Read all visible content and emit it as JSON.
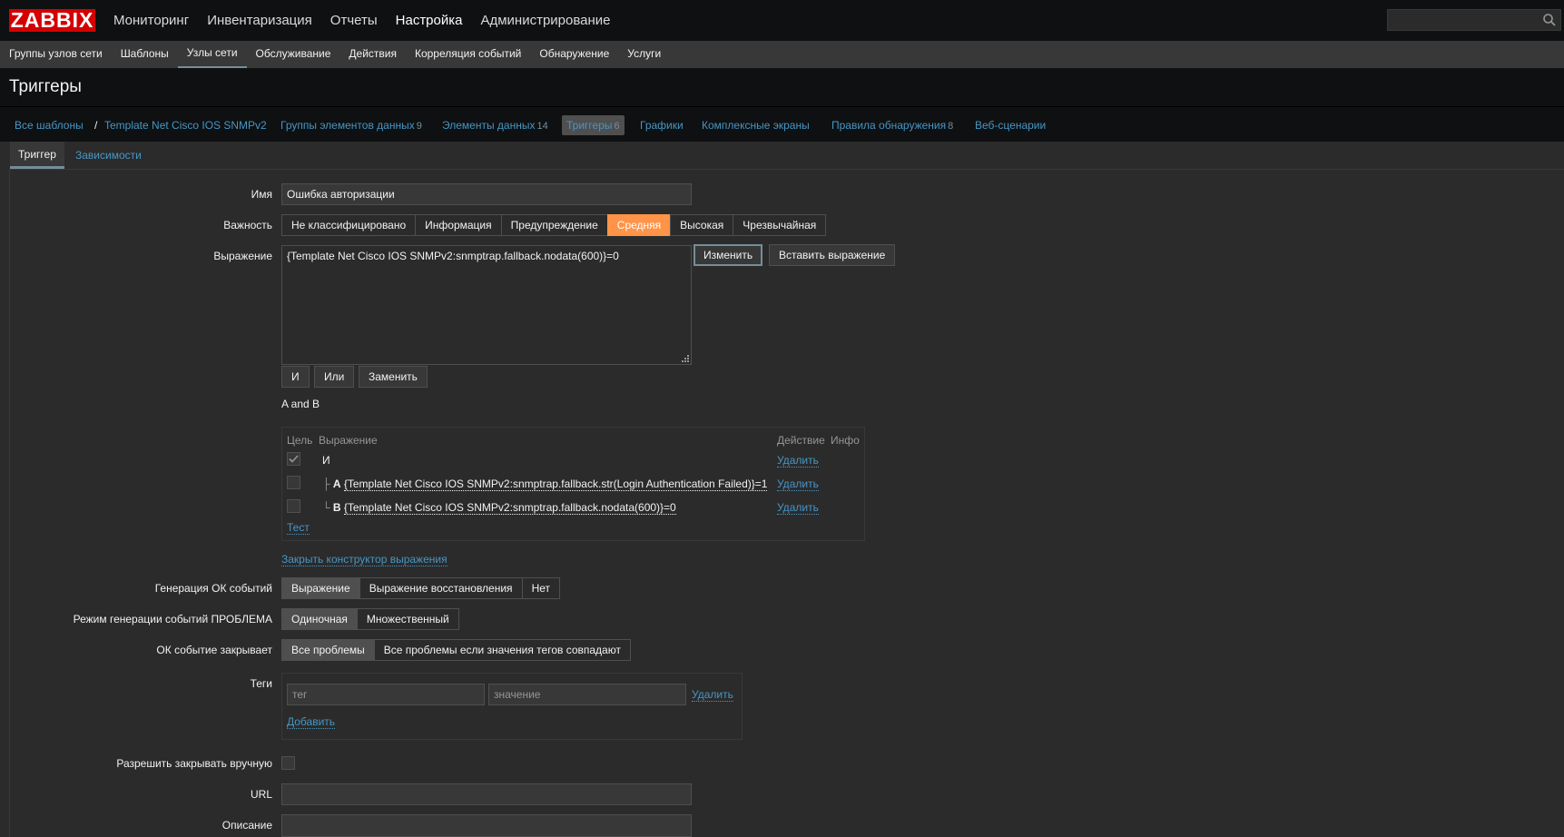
{
  "header": {
    "logo": "ZABBIX",
    "menu": [
      "Мониторинг",
      "Инвентаризация",
      "Отчеты",
      "Настройка",
      "Администрирование"
    ],
    "selected_menu": "Настройка"
  },
  "submenu": {
    "items": [
      "Группы узлов сети",
      "Шаблоны",
      "Узлы сети",
      "Обслуживание",
      "Действия",
      "Корреляция событий",
      "Обнаружение",
      "Услуги"
    ],
    "selected": "Узлы сети"
  },
  "page_title": "Триггеры",
  "nav": {
    "all_templates": "Все шаблоны",
    "separator": "/",
    "template": "Template Net Cisco IOS SNMPv2",
    "items": [
      {
        "label": "Группы элементов данных",
        "count": "9"
      },
      {
        "label": "Элементы данных",
        "count": "14"
      },
      {
        "label": "Триггеры",
        "count": "6"
      },
      {
        "label": "Графики",
        "count": ""
      },
      {
        "label": "Комплексные экраны",
        "count": ""
      },
      {
        "label": "Правила обнаружения",
        "count": "8"
      },
      {
        "label": "Веб-сценарии",
        "count": ""
      }
    ]
  },
  "tabs": [
    "Триггер",
    "Зависимости"
  ],
  "form": {
    "name_label": "Имя",
    "name_value": "Ошибка авторизации",
    "severity_label": "Важность",
    "severity_options": [
      "Не классифицировано",
      "Информация",
      "Предупреждение",
      "Средняя",
      "Высокая",
      "Чрезвычайная"
    ],
    "severity_selected": "Средняя",
    "expression_label": "Выражение",
    "expression_value": "{Template Net Cisco IOS SNMPv2:snmptrap.fallback.nodata(600)}=0",
    "edit_button": "Изменить",
    "insert_button": "Вставить выражение",
    "and_button": "И",
    "or_button": "Или",
    "replace_button": "Заменить",
    "formula": "A and B",
    "constructor": {
      "headers": {
        "target": "Цель",
        "expression": "Выражение",
        "action": "Действие",
        "info": "Инфо"
      },
      "rows": [
        {
          "prefix": "",
          "letter": "",
          "expression": "И",
          "action": "Удалить",
          "checked": true
        },
        {
          "prefix": "├",
          "letter": "A",
          "expression": "{Template Net Cisco IOS SNMPv2:snmptrap.fallback.str(Login Authentication Failed)}=1",
          "action": "Удалить",
          "checked": false
        },
        {
          "prefix": "└",
          "letter": "B",
          "expression": "{Template Net Cisco IOS SNMPv2:snmptrap.fallback.nodata(600)}=0",
          "action": "Удалить",
          "checked": false
        }
      ],
      "test_link": "Тест"
    },
    "close_constructor": "Закрыть конструктор выражения",
    "ok_gen_label": "Генерация ОК событий",
    "ok_gen_options": [
      "Выражение",
      "Выражение восстановления",
      "Нет"
    ],
    "ok_gen_selected": "Выражение",
    "problem_mode_label": "Режим генерации событий ПРОБЛЕМА",
    "problem_mode_options": [
      "Одиночная",
      "Множественный"
    ],
    "problem_mode_selected": "Одиночная",
    "ok_close_label": "ОК событие закрывает",
    "ok_close_options": [
      "Все проблемы",
      "Все проблемы если значения тегов совпадают"
    ],
    "ok_close_selected": "Все проблемы",
    "tags_label": "Теги",
    "tag_placeholder": "тег",
    "value_placeholder": "значение",
    "tag_remove": "Удалить",
    "tag_add": "Добавить",
    "manual_close_label": "Разрешить закрывать вручную",
    "url_label": "URL",
    "url_value": "",
    "description_label": "Описание",
    "description_value": ""
  },
  "colors": {
    "accent": "#4796c4",
    "severity_average": "#ff9347",
    "logo": "#d40000"
  }
}
